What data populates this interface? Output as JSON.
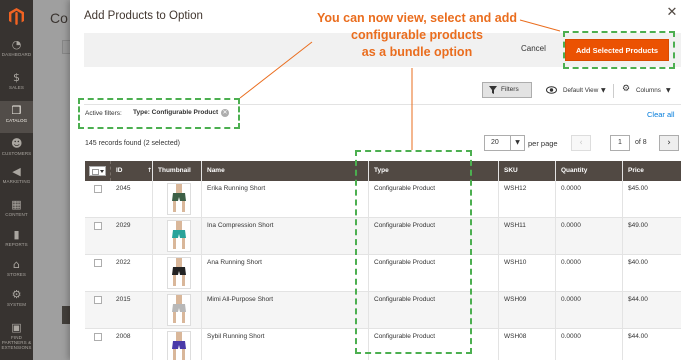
{
  "sidebar": {
    "logo": "magento-logo",
    "items": [
      {
        "label": "DASHBOARD",
        "icon": "speedometer-icon"
      },
      {
        "label": "SALES",
        "icon": "dollar-icon"
      },
      {
        "label": "CATALOG",
        "icon": "cube-icon"
      },
      {
        "label": "CUSTOMERS",
        "icon": "person-icon"
      },
      {
        "label": "MARKETING",
        "icon": "megaphone-icon"
      },
      {
        "label": "CONTENT",
        "icon": "content-icon"
      },
      {
        "label": "REPORTS",
        "icon": "bar-chart-icon"
      },
      {
        "label": "STORES",
        "icon": "store-icon"
      },
      {
        "label": "SYSTEM",
        "icon": "gear-icon"
      },
      {
        "label": "FIND PARTNERS & EXTENSIONS",
        "icon": "partners-icon"
      }
    ],
    "active_index": 2
  },
  "background": {
    "page_title": "Co"
  },
  "modal": {
    "title": "Add Products to Option",
    "cancel_label": "Cancel",
    "add_label": "Add Selected Products"
  },
  "toolbar": {
    "filters_label": "Filters",
    "view_label": "Default View",
    "columns_label": "Columns"
  },
  "active_filters": {
    "label": "Active filters:",
    "chip_key": "Type:",
    "chip_value": "Configurable Product",
    "clear_all": "Clear all"
  },
  "pagination": {
    "records": "145 records found (2 selected)",
    "per_page_value": "20",
    "per_page_label": "per page",
    "current_page": "1",
    "total_pages": "of 8"
  },
  "table": {
    "columns": [
      "ID",
      "Thumbnail",
      "Name",
      "Type",
      "SKU",
      "Quantity",
      "Price"
    ],
    "rows": [
      {
        "id": "2045",
        "name": "Erika Running Short",
        "type": "Configurable Product",
        "sku": "WSH12",
        "qty": "0.0000",
        "price": "$45.00",
        "thumb_color": "#3d5f46"
      },
      {
        "id": "2029",
        "name": "Ina Compression Short",
        "type": "Configurable Product",
        "sku": "WSH11",
        "qty": "0.0000",
        "price": "$49.00",
        "thumb_color": "#2aa39a"
      },
      {
        "id": "2022",
        "name": "Ana Running Short",
        "type": "Configurable Product",
        "sku": "WSH10",
        "qty": "0.0000",
        "price": "$40.00",
        "thumb_color": "#222222"
      },
      {
        "id": "2015",
        "name": "Mimi All-Purpose Short",
        "type": "Configurable Product",
        "sku": "WSH09",
        "qty": "0.0000",
        "price": "$44.00",
        "thumb_color": "#b8b8b8"
      },
      {
        "id": "2008",
        "name": "Sybil Running Short",
        "type": "Configurable Product",
        "sku": "WSH08",
        "qty": "0.0000",
        "price": "$44.00",
        "thumb_color": "#4a3aa8"
      }
    ]
  },
  "callout": {
    "line1": "You can now view, select and add",
    "line2": "configurable products",
    "line3": "as a bundle option"
  },
  "colors": {
    "accent": "#eb5202",
    "callout": "#ea6d1e",
    "highlight": "#4caf50",
    "header": "#514943"
  }
}
